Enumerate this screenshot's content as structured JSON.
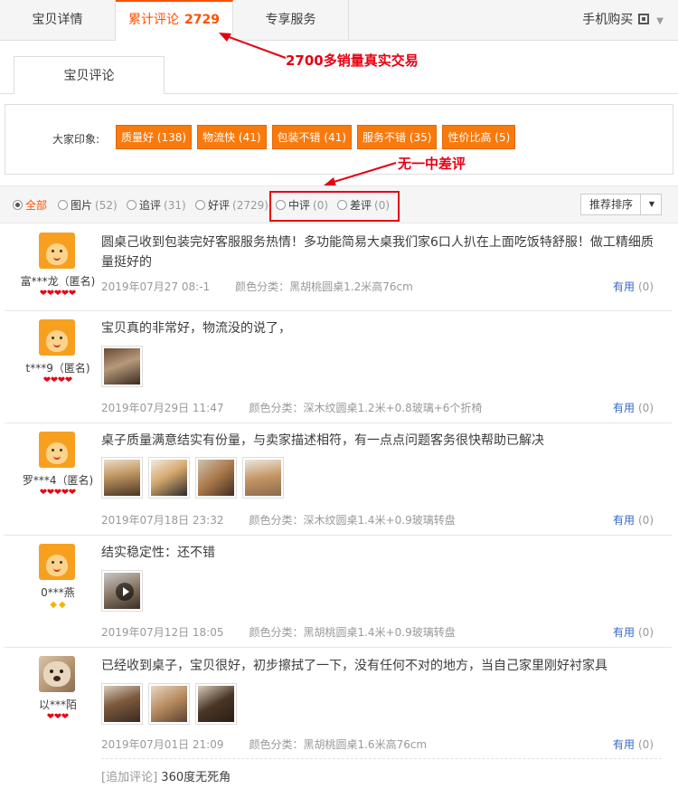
{
  "top_tabs": {
    "detail": "宝贝详情",
    "reviews": "累计评论",
    "reviews_count": "2729",
    "service": "专享服务",
    "mobile": "手机购买"
  },
  "annotations": {
    "sales_note": "2700多销量真实交易",
    "no_bad_note": "无一中差评"
  },
  "sub_tab": "宝贝评论",
  "impressions": {
    "label": "大家印象:",
    "tags": [
      "质量好 (138)",
      "物流快 (41)",
      "包装不错 (41)",
      "服务不错 (35)",
      "性价比高 (5)"
    ]
  },
  "filters": {
    "all": "全部",
    "pics": "图片",
    "pics_count": "(52)",
    "append": "追评",
    "append_count": "(31)",
    "good": "好评",
    "good_count": "(2729)",
    "mid": "中评",
    "mid_count": "(0)",
    "bad": "差评",
    "bad_count": "(0)",
    "sort": "推荐排序"
  },
  "useful_label": "有用",
  "useful_count": "(0)",
  "reviews": [
    {
      "user": "富***龙（匿名)",
      "content": "圆桌己收到包装完好客服服务热情！多功能简易大桌我们家6口人扒在上面吃饭特舒服！做工精细质量挺好的",
      "date": "2019年07月27  08:-1",
      "sku": "颜色分类：黑胡桃圆桌1.2米高76cm"
    },
    {
      "user": "t***9（匿名)",
      "content": "宝贝真的非常好，物流没的说了，",
      "date": "2019年07月29日 11:47",
      "sku": "颜色分类：深木纹圆桌1.2米+0.8玻璃+6个折椅"
    },
    {
      "user": "罗***4（匿名)",
      "content": "桌子质量满意结实有份量，与卖家描述相符，有一点点问题客务很快帮助已解决",
      "date": "2019年07月18日 23:32",
      "sku": "颜色分类：深木纹圆桌1.4米+0.9玻璃转盘"
    },
    {
      "user": "0***燕",
      "content": "结实稳定性：还不错",
      "date": "2019年07月12日 18:05",
      "sku": "颜色分类：黑胡桃圆桌1.4米+0.9玻璃转盘"
    },
    {
      "user": "以***陌",
      "content": "已经收到桌子，宝贝很好，初步擦拭了一下，没有任何不对的地方，当自己家里刚好衬家具",
      "date": "2019年07月01日 21:09",
      "sku": "颜色分类：黑胡桃圆桌1.6米高76cm",
      "append_tag": "[追加评论]",
      "append_text": "360度无死角"
    }
  ]
}
